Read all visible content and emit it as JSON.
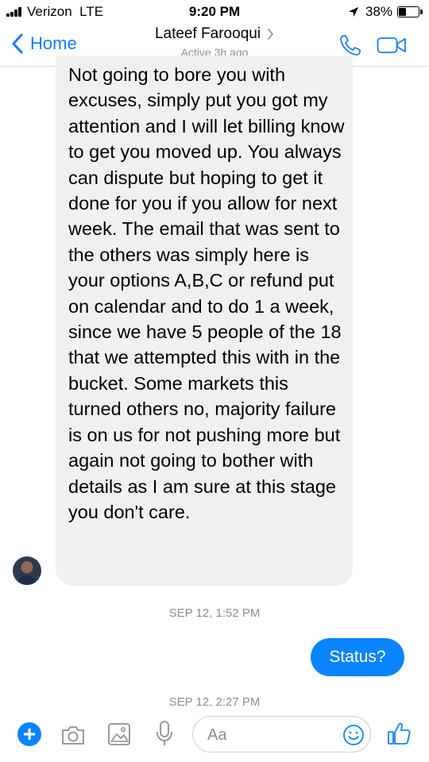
{
  "status_bar": {
    "carrier": "Verizon",
    "network": "LTE",
    "time": "9:20 PM",
    "battery": "38%",
    "battery_level": 0.38
  },
  "header": {
    "back_label": "Home",
    "contact_name": "Lateef Farooqui",
    "contact_status": "Active 3h ago",
    "icons": [
      "phone-icon",
      "video-icon"
    ]
  },
  "messages": {
    "incoming_text": "Not going to bore you with excuses, simply put you got my attention and I will let billing know to get you moved up. You always can dispute but hoping to get it done for you if you allow for next week. The email that was sent to the others was simply here is your options A,B,C or refund put on calendar and to do 1 a week, since we have 5 people of the 18 that we attempted this with in the bucket. Some markets this turned others no, majority failure is on us for not pushing more but again not going to bother with details as I am sure at this stage you don't care.",
    "timestamp_1": "SEP 12, 1:52 PM",
    "outgoing_text": "Status?",
    "timestamp_2": "SEP 12, 2:27 PM"
  },
  "composer": {
    "placeholder": "Aa",
    "icons": [
      "plus-icon",
      "camera-icon",
      "photo-icon",
      "mic-icon",
      "emoji-icon",
      "like-icon"
    ]
  },
  "colors": {
    "accent": "#0a84ff",
    "link": "#1a7cf3",
    "incoming_bubble": "#f0f0f0",
    "secondary_text": "#8e8e93"
  }
}
